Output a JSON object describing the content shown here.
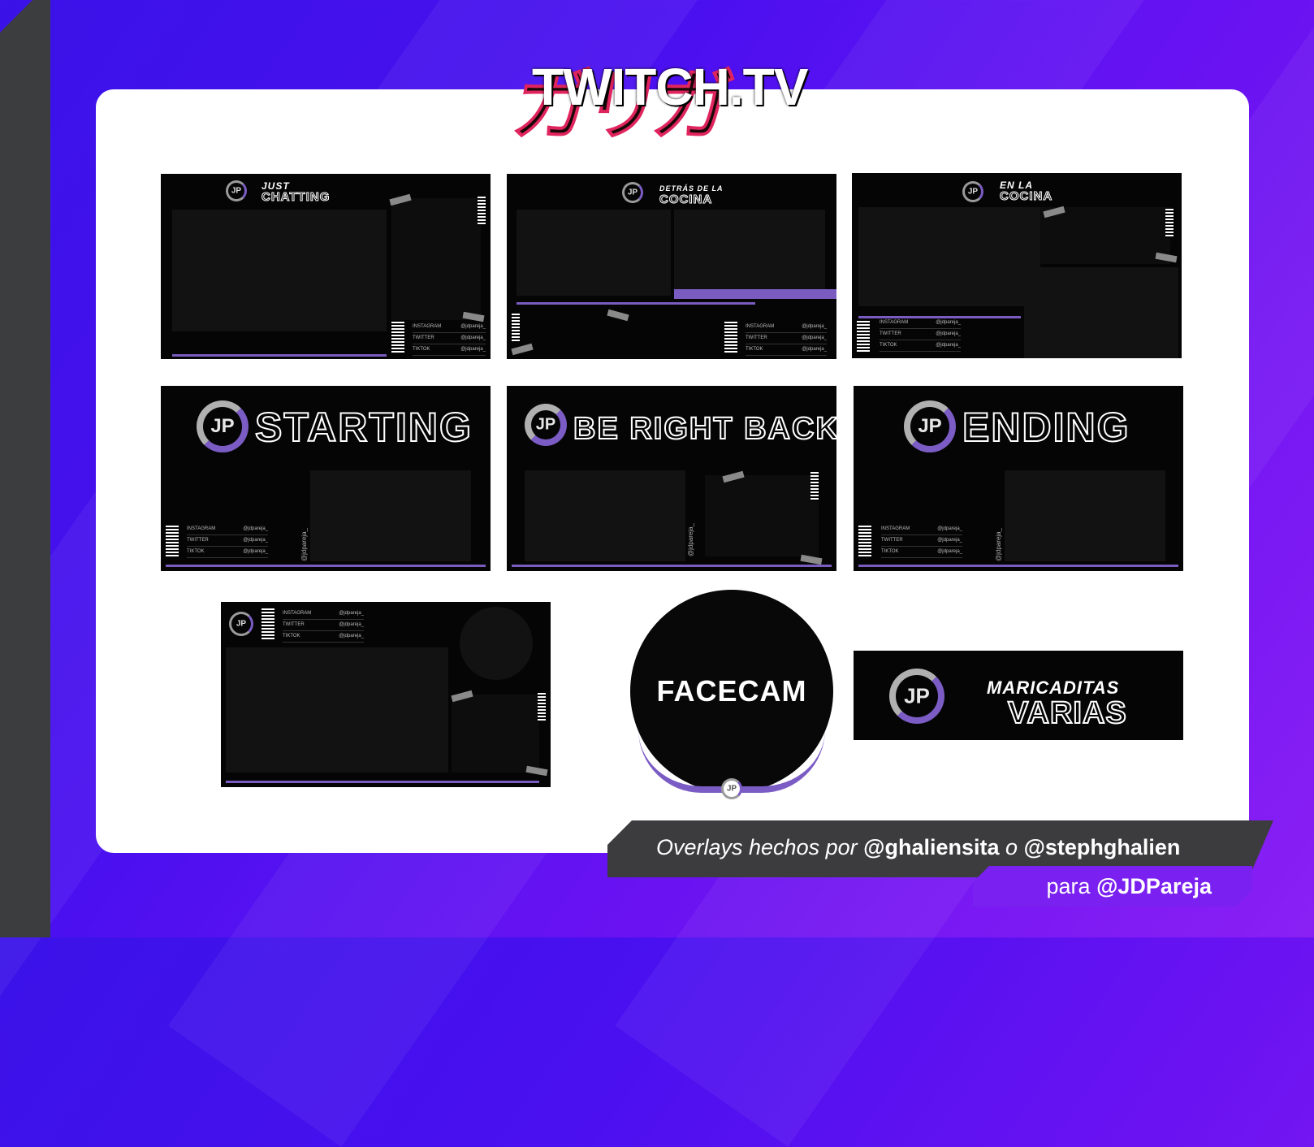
{
  "header": {
    "logo_text": "TWITCH.TV",
    "logo_kanji": "ガリガ"
  },
  "overlays": {
    "just_chatting": {
      "line1": "JUST",
      "line2": "CHATTING"
    },
    "detras": {
      "line1": "DETRÁS DE LA",
      "line2": "COCINA"
    },
    "en_la": {
      "line1": "EN LA",
      "line2": "COCINA"
    },
    "starting": {
      "title": "STARTING"
    },
    "brb": {
      "title": "BE RIGHT BACK"
    },
    "ending": {
      "title": "ENDING"
    },
    "maricaditas": {
      "line1": "MARICADITAS",
      "line2": "VARIAS"
    },
    "facecam": {
      "title": "FACECAM"
    },
    "logo_initials": "JP",
    "vertical_handle": "@jdpareja_"
  },
  "social": [
    {
      "network": "INSTAGRAM",
      "handle": "@jdpareja_"
    },
    {
      "network": "TWITTER",
      "handle": "@jdpareja_"
    },
    {
      "network": "TIKTOK",
      "handle": "@jdpareja_"
    }
  ],
  "credits": {
    "prefix": "Overlays hechos por",
    "author1": "@ghaliensita",
    "connector": "o",
    "author2": "@stephghalien",
    "para": "para",
    "client": "@JDPareja"
  },
  "colors": {
    "accent_purple": "#7a5cc0",
    "bg_blue": "#3a12e8",
    "bg_purple": "#8a20f4",
    "kanji_pink": "#e0245e",
    "credit_dark": "#3c3c3e"
  }
}
